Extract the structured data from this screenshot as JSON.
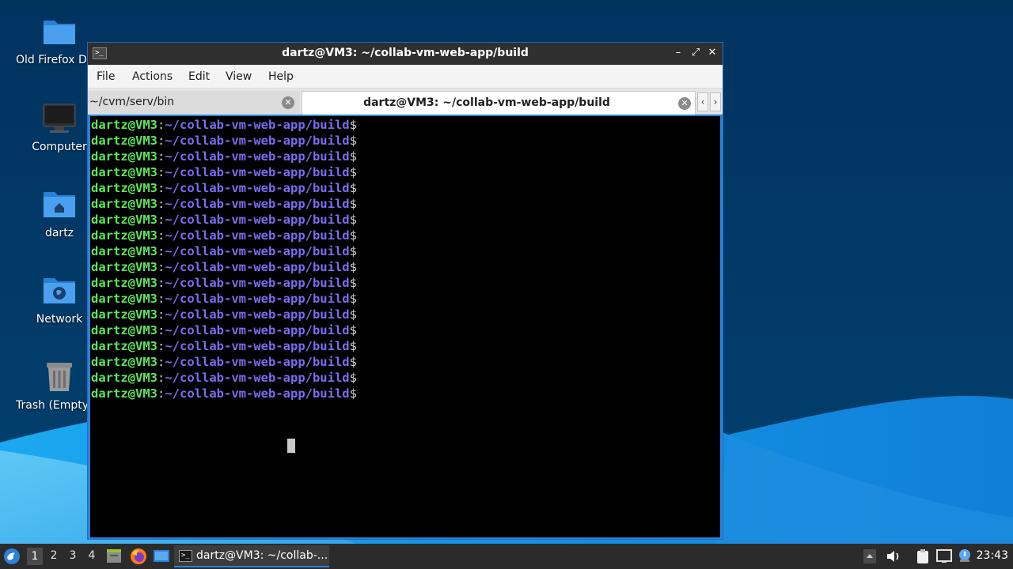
{
  "desktop": {
    "icons": [
      {
        "label": "Old Firefox Data",
        "icon": "folder-icon"
      },
      {
        "label": "Computer",
        "icon": "computer-icon"
      },
      {
        "label": "dartz",
        "icon": "home-folder-icon"
      },
      {
        "label": "Network",
        "icon": "network-folder-icon"
      },
      {
        "label": "Trash (Empty)",
        "icon": "trash-icon"
      }
    ]
  },
  "window": {
    "title": "dartz@VM3: ~/collab-vm-web-app/build",
    "menu": [
      "File",
      "Actions",
      "Edit",
      "View",
      "Help"
    ],
    "tabs": [
      {
        "label": "~/cvm/serv/bin",
        "active": false
      },
      {
        "label": "dartz@VM3: ~/collab-vm-web-app/build",
        "active": true
      }
    ],
    "terminal": {
      "prompt_user": "dartz@VM3",
      "prompt_colon": ":",
      "prompt_path": "~/collab-vm-web-app/build",
      "prompt_dollar": "$",
      "line_count": 18
    },
    "colors": {
      "prompt_user": "#5ce65c",
      "prompt_path": "#7b6cf0",
      "frame": "#2a82da"
    }
  },
  "taskbar": {
    "workspaces": [
      "1",
      "2",
      "3",
      "4"
    ],
    "active_workspace": "1",
    "task_label": "dartz@VM3: ~/collab-...",
    "clock": "23:43"
  }
}
